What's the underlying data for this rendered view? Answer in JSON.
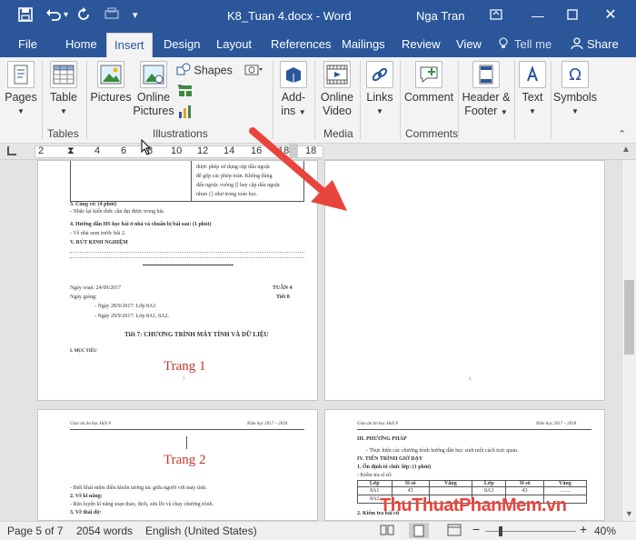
{
  "window": {
    "doc_title": "K8_Tuan 4.docx - Word",
    "user": "Nga Tran",
    "qat": {
      "save_icon": "save-icon",
      "undo_icon": "undo-icon",
      "redo_icon": "redo-icon"
    }
  },
  "tabs": [
    {
      "label": "File"
    },
    {
      "label": "Home"
    },
    {
      "label": "Insert"
    },
    {
      "label": "Design"
    },
    {
      "label": "Layout"
    },
    {
      "label": "References"
    },
    {
      "label": "Mailings"
    },
    {
      "label": "Review"
    },
    {
      "label": "View"
    },
    {
      "label": "Tell me"
    },
    {
      "label": "Share"
    }
  ],
  "ribbon": {
    "buttons": {
      "pages": "Pages",
      "table": "Table",
      "pictures": "Pictures",
      "online_pictures_1": "Online",
      "online_pictures_2": "Pictures",
      "shapes": "Shapes",
      "addins_1": "Add-",
      "addins_2": "ins",
      "online_video_1": "Online",
      "online_video_2": "Video",
      "links": "Links",
      "comment": "Comment",
      "header_footer_1": "Header &",
      "header_footer_2": "Footer",
      "text": "Text",
      "symbols": "Symbols"
    },
    "groups": {
      "tables": "Tables",
      "illustrations": "Illustrations",
      "media": "Media",
      "comments": "Comments"
    }
  },
  "ruler": {
    "numbers": [
      "2",
      "2",
      "4",
      "6",
      "8",
      "10",
      "12",
      "14",
      "16",
      "18"
    ]
  },
  "pages": {
    "p1": {
      "table_lines": [
        "được phép sử dụng cặp dấu ngoặc",
        "để gộp các phép toán. Không dùng",
        "dấu ngoặc vuông [] hay cặp dấu ngoặc",
        "nhọn {} như trong toán học."
      ],
      "cung_co": "3. Củng cố: (4 phút)",
      "cung_co_sub": "- Nhắc lại kiến thức cần đạt được trong bài.",
      "huong_dan": "4. Hướng dẫn HS học bài ở nhà và chuẩn bị bài sau: (1 phút)",
      "huong_dan_sub": "- Về nhà xem trước bài 2.",
      "rut_kinh_nghiem": "V. RÚT KINH NGHIỆM",
      "ngay_soan": "Ngày soạn: 24/09/2017",
      "tuan": "TUẦN 4",
      "ngay_giang": "Ngày giảng:",
      "tiet": "Tiết 8",
      "lop_1": "- Ngày 28/9/2017: Lớp 8A3",
      "lop_2": "- Ngày 29/9/2017: Lớp 8A1, 8A2.",
      "heading": "Tiết 7: CHƯƠNG TRÌNH MÁY TÍNH VÀ DỮ LIỆU",
      "muc_tieu": "I. MỤC TIÊU",
      "label": "Trang 1",
      "page_num": "3"
    },
    "p2": {
      "page_num": "4"
    },
    "p3": {
      "header_left": "Giáo án tin học khối 8",
      "header_right": "Năm học 2017 – 2018",
      "label": "Trang 2",
      "line_1": "- Biết khái niệm điều khiển tương tác giữa người với máy tính.",
      "ky_nang": "2. Về kĩ năng:",
      "line_2": "- Rèn luyện kĩ năng soạn thảo, dịch, sửa lỗi và chạy chương trình.",
      "thai_do": "3. Về thái độ:"
    },
    "p4": {
      "header_left": "Giáo án tin học khối 8",
      "header_right": "Năm học 2017 – 2018",
      "phuong_phap": "III. PHƯƠNG PHÁP",
      "pp_line": "- Thực hiện các chương trình hướng dẫn học sinh một cách trực quan.",
      "tien_trinh": "IV. TIẾN TRÌNH GIỜ DẠY",
      "on_dinh": "1. Ổn định tổ chức lớp: (1 phút)",
      "kiem_tra_si_so": "- Kiểm tra sĩ số:",
      "table_headers": [
        "Lớp",
        "Sĩ số",
        "Vắng",
        "Lớp",
        "Sĩ số",
        "Vắng"
      ],
      "table_rows": [
        [
          "8A1",
          "43",
          "",
          "8A3",
          "43",
          "........"
        ],
        [
          "8A2",
          "",
          "",
          "",
          "",
          ""
        ]
      ],
      "kiem_tra": "2. Kiểm tra bài cũ"
    }
  },
  "status": {
    "page": "Page 5 of 7",
    "words": "2054 words",
    "language": "English (United States)",
    "zoom": "40%"
  },
  "watermark": "ThuThuatPhanMem.vn",
  "colors": {
    "accent": "#2b579a",
    "arrow": "#e8453c",
    "page_label": "#c0392b"
  }
}
